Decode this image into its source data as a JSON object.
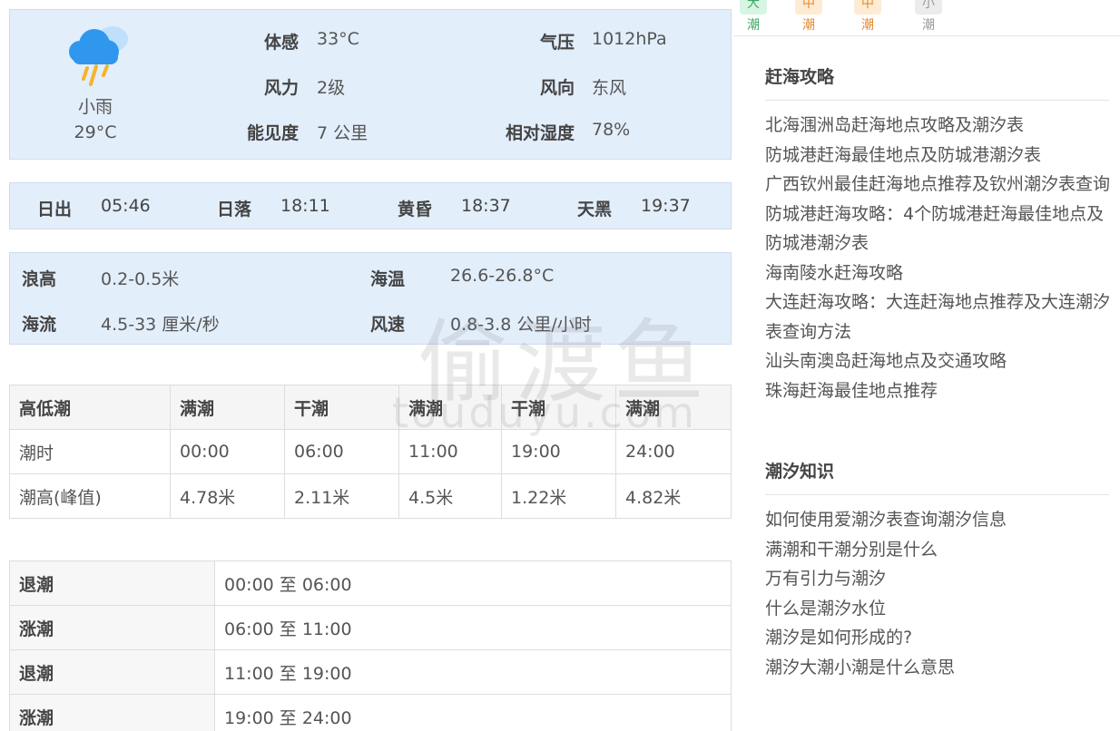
{
  "weather": {
    "desc": "小雨",
    "temp": "29°C",
    "rows": [
      {
        "l1": "体感",
        "v1": "33°C",
        "l2": "气压",
        "v2": "1012hPa"
      },
      {
        "l1": "风力",
        "v1": "2级",
        "l2": "风向",
        "v2": "东风"
      },
      {
        "l1": "能见度",
        "v1": "7 公里",
        "l2": "相对湿度",
        "v2": "78%"
      }
    ]
  },
  "sun": {
    "sunrise_label": "日出",
    "sunrise": "05:46",
    "sunset_label": "日落",
    "sunset": "18:11",
    "dusk_label": "黄昏",
    "dusk": "18:37",
    "dark_label": "天黑",
    "dark": "19:37"
  },
  "sea": {
    "wave_label": "浪高",
    "wave": "0.2-0.5米",
    "temp_label": "海温",
    "temp": "26.6-26.8°C",
    "current_label": "海流",
    "current": "4.5-33 厘米/秒",
    "wind_label": "风速",
    "wind": "0.8-3.8 公里/小时"
  },
  "tide_table": {
    "headers": [
      "高低潮",
      "满潮",
      "干潮",
      "满潮",
      "干潮",
      "满潮"
    ],
    "time_label": "潮时",
    "times": [
      "00:00",
      "06:00",
      "11:00",
      "19:00",
      "24:00"
    ],
    "height_label": "潮高(峰值)",
    "heights": [
      "4.78米",
      "2.11米",
      "4.5米",
      "1.22米",
      "4.82米"
    ]
  },
  "phases": [
    {
      "type": "退潮",
      "range": "00:00 至 06:00"
    },
    {
      "type": "涨潮",
      "range": "06:00 至 11:00"
    },
    {
      "type": "退潮",
      "range": "11:00 至 19:00"
    },
    {
      "type": "涨潮",
      "range": "19:00 至 24:00"
    }
  ],
  "watermark": {
    "cn": "偷渡鱼",
    "en": "touduyu.com"
  },
  "tags": [
    {
      "label": "大潮",
      "bg": "#d8f5e3",
      "color": "#3aa864"
    },
    {
      "label": "中潮",
      "bg": "#fdebd3",
      "color": "#e28a2b"
    },
    {
      "label": "中潮",
      "bg": "#fdebd3",
      "color": "#e28a2b"
    },
    {
      "label": "小潮",
      "bg": "#ececec",
      "color": "#999999"
    }
  ],
  "guide": {
    "title": "赶海攻略",
    "items": [
      "北海涠洲岛赶海地点攻略及潮汐表",
      "防城港赶海最佳地点及防城港潮汐表",
      "广西钦州最佳赶海地点推荐及钦州潮汐表查询",
      "防城港赶海攻略：4个防城港赶海最佳地点及防城港潮汐表",
      "海南陵水赶海攻略",
      "大连赶海攻略：大连赶海地点推荐及大连潮汐表查询方法",
      "汕头南澳岛赶海地点及交通攻略",
      "珠海赶海最佳地点推荐"
    ]
  },
  "knowledge": {
    "title": "潮汐知识",
    "items": [
      "如何使用爱潮汐表查询潮汐信息",
      "满潮和干潮分别是什么",
      "万有引力与潮汐",
      "什么是潮汐水位",
      "潮汐是如何形成的?",
      "潮汐大潮小潮是什么意思"
    ]
  },
  "colors": {
    "panel_bg": "#e3eefb",
    "rain_cloud": "#2f97ee",
    "rain_drop": "#f5b52a"
  }
}
